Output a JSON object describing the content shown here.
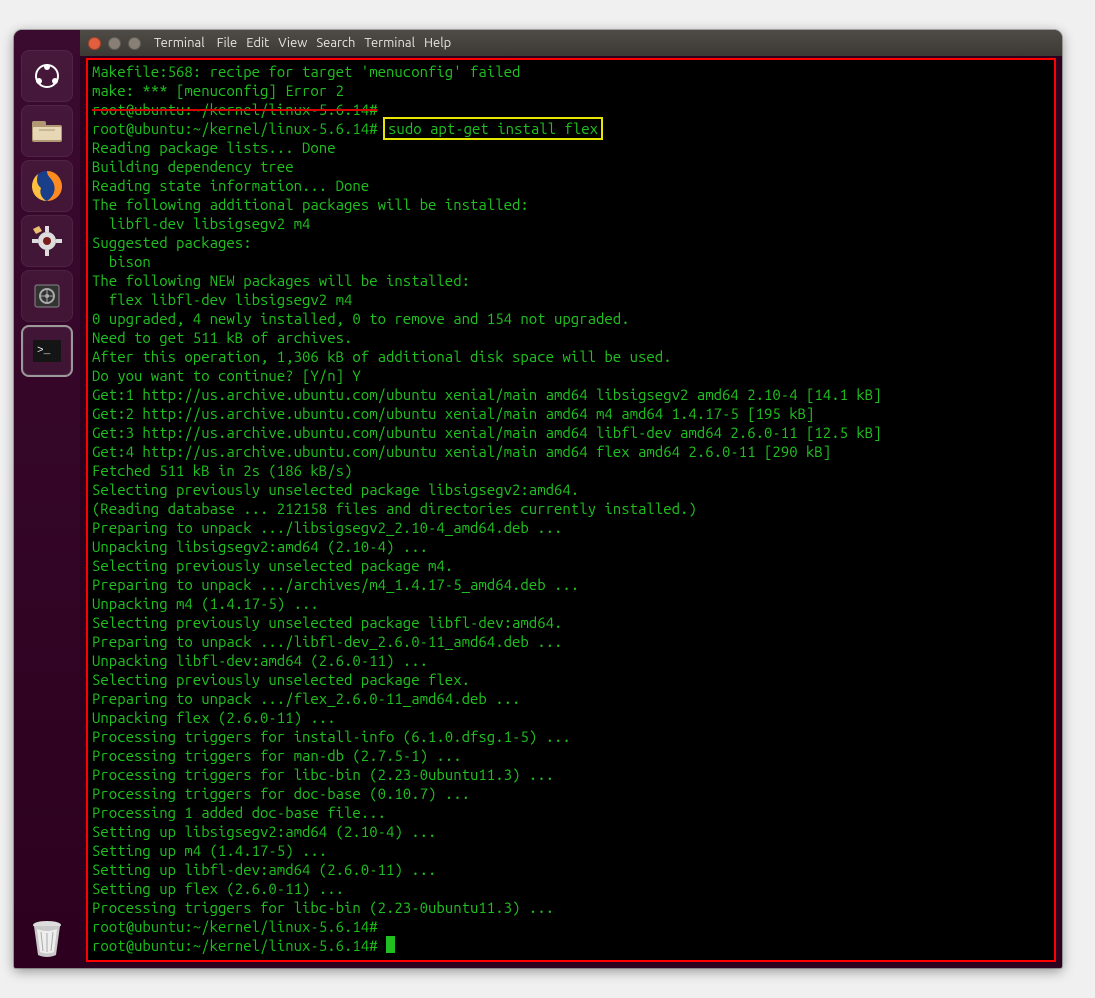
{
  "window": {
    "title": "Terminal"
  },
  "menubar": [
    "File",
    "Edit",
    "View",
    "Search",
    "Terminal",
    "Help"
  ],
  "launcher": {
    "items": [
      "ubuntu-dash",
      "files",
      "firefox",
      "settings",
      "safe",
      "terminal"
    ],
    "trash": "trash"
  },
  "annotations": {
    "red_box": "highlights apt-get install output session",
    "yellow_box": "highlights the command that was typed"
  },
  "terminal": {
    "font": "monospace",
    "fg": "green",
    "bg": "black",
    "prompt_user": "root",
    "prompt_host": "ubuntu",
    "prompt_cwd": "~/kernel/linux-5.6.14",
    "highlighted_command": "sudo apt-get install flex",
    "lines": [
      {
        "t": "Makefile:568: recipe for target 'menuconfig' failed"
      },
      {
        "t": "make: *** [menuconfig] Error 2"
      },
      {
        "t": "root@ubuntu:~/kernel/linux-5.6.14#",
        "strike": true
      },
      {
        "prompt": "root@ubuntu:~/kernel/linux-5.6.14#",
        "cmd": "sudo apt-get install flex",
        "highlight": true
      },
      {
        "t": "Reading package lists... Done"
      },
      {
        "t": "Building dependency tree"
      },
      {
        "t": "Reading state information... Done"
      },
      {
        "t": "The following additional packages will be installed:"
      },
      {
        "t": "  libfl-dev libsigsegv2 m4"
      },
      {
        "t": "Suggested packages:"
      },
      {
        "t": "  bison"
      },
      {
        "t": "The following NEW packages will be installed:"
      },
      {
        "t": "  flex libfl-dev libsigsegv2 m4"
      },
      {
        "t": "0 upgraded, 4 newly installed, 0 to remove and 154 not upgraded."
      },
      {
        "t": "Need to get 511 kB of archives."
      },
      {
        "t": "After this operation, 1,306 kB of additional disk space will be used."
      },
      {
        "t": "Do you want to continue? [Y/n] Y"
      },
      {
        "t": "Get:1 http://us.archive.ubuntu.com/ubuntu xenial/main amd64 libsigsegv2 amd64 2.10-4 [14.1 kB]"
      },
      {
        "t": "Get:2 http://us.archive.ubuntu.com/ubuntu xenial/main amd64 m4 amd64 1.4.17-5 [195 kB]"
      },
      {
        "t": "Get:3 http://us.archive.ubuntu.com/ubuntu xenial/main amd64 libfl-dev amd64 2.6.0-11 [12.5 kB]"
      },
      {
        "t": "Get:4 http://us.archive.ubuntu.com/ubuntu xenial/main amd64 flex amd64 2.6.0-11 [290 kB]"
      },
      {
        "t": "Fetched 511 kB in 2s (186 kB/s)"
      },
      {
        "t": "Selecting previously unselected package libsigsegv2:amd64."
      },
      {
        "t": "(Reading database ... 212158 files and directories currently installed.)"
      },
      {
        "t": "Preparing to unpack .../libsigsegv2_2.10-4_amd64.deb ..."
      },
      {
        "t": "Unpacking libsigsegv2:amd64 (2.10-4) ..."
      },
      {
        "t": "Selecting previously unselected package m4."
      },
      {
        "t": "Preparing to unpack .../archives/m4_1.4.17-5_amd64.deb ..."
      },
      {
        "t": "Unpacking m4 (1.4.17-5) ..."
      },
      {
        "t": "Selecting previously unselected package libfl-dev:amd64."
      },
      {
        "t": "Preparing to unpack .../libfl-dev_2.6.0-11_amd64.deb ..."
      },
      {
        "t": "Unpacking libfl-dev:amd64 (2.6.0-11) ..."
      },
      {
        "t": "Selecting previously unselected package flex."
      },
      {
        "t": "Preparing to unpack .../flex_2.6.0-11_amd64.deb ..."
      },
      {
        "t": "Unpacking flex (2.6.0-11) ..."
      },
      {
        "t": "Processing triggers for install-info (6.1.0.dfsg.1-5) ..."
      },
      {
        "t": "Processing triggers for man-db (2.7.5-1) ..."
      },
      {
        "t": "Processing triggers for libc-bin (2.23-0ubuntu11.3) ..."
      },
      {
        "t": "Processing triggers for doc-base (0.10.7) ..."
      },
      {
        "t": "Processing 1 added doc-base file..."
      },
      {
        "t": "Setting up libsigsegv2:amd64 (2.10-4) ..."
      },
      {
        "t": "Setting up m4 (1.4.17-5) ..."
      },
      {
        "t": "Setting up libfl-dev:amd64 (2.6.0-11) ..."
      },
      {
        "t": "Setting up flex (2.6.0-11) ..."
      },
      {
        "t": "Processing triggers for libc-bin (2.23-0ubuntu11.3) ..."
      },
      {
        "prompt": "root@ubuntu:~/kernel/linux-5.6.14#",
        "cmd": ""
      },
      {
        "prompt": "root@ubuntu:~/kernel/linux-5.6.14#",
        "cmd": "",
        "cursor": true
      }
    ]
  }
}
